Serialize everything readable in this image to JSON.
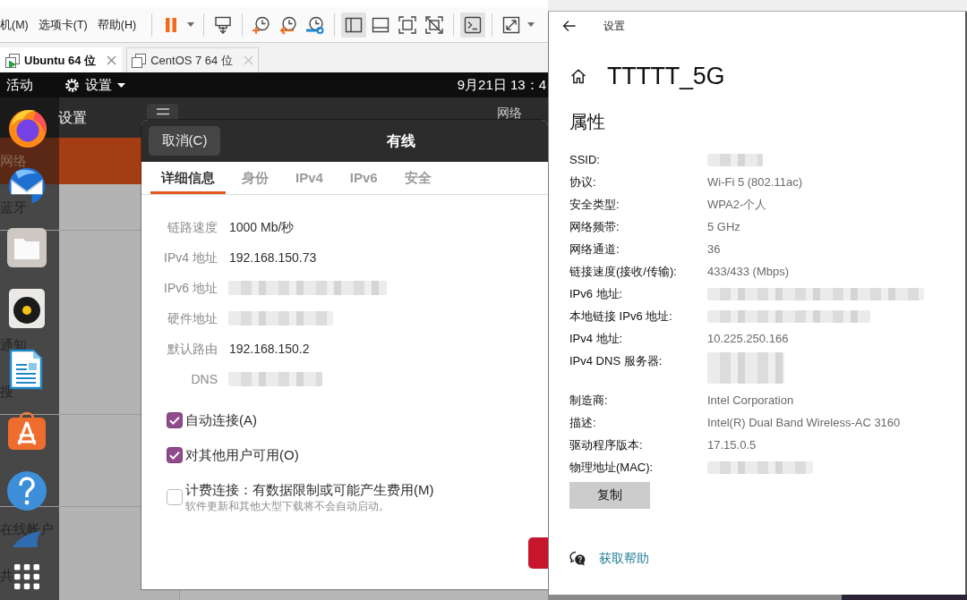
{
  "vmware": {
    "menu": [
      "机(M)",
      "选项卡(T)",
      "帮助(H)"
    ],
    "toolbar": [
      [
        {
          "on": false,
          "dropdown": true
        }
      ],
      [
        {
          "on": false,
          "dropdown": false
        }
      ],
      [
        {
          "on": false,
          "dropdown": false
        },
        {
          "on": false,
          "dropdown": false
        },
        {
          "on": false,
          "dropdown": false
        }
      ],
      [
        {
          "on": true,
          "dropdown": false
        },
        {
          "on": false,
          "dropdown": false
        },
        {
          "on": false,
          "dropdown": false
        },
        {
          "on": false,
          "dropdown": false
        }
      ],
      [
        {
          "on": true,
          "dropdown": false
        }
      ],
      [
        {
          "on": false,
          "dropdown": true
        }
      ]
    ],
    "tabs": [
      {
        "label": "Ubuntu 64 位",
        "selected": true,
        "running": true
      },
      {
        "label": "CentOS 7 64 位",
        "selected": false,
        "running": false
      }
    ]
  },
  "ubuntu": {
    "top_bar": {
      "activities": "活动",
      "app_menu": "设置",
      "clock": "9月21日 13：4"
    },
    "settings": {
      "title": "设置",
      "panel_title": "网络",
      "sidebar": [
        {
          "label": "网络",
          "selected": true,
          "group_start": false
        },
        {
          "label": "蓝牙",
          "selected": false,
          "group_start": false
        },
        {
          "selected": false,
          "group_start": true
        },
        {
          "selected": false,
          "group_start": false
        },
        {
          "label": "通知",
          "selected": false,
          "group_start": false
        },
        {
          "label": "搜",
          "selected": false,
          "group_start": false
        },
        {
          "selected": false,
          "group_start": true
        },
        {
          "selected": false,
          "group_start": false
        },
        {
          "label": "在线帐户",
          "selected": false,
          "group_start": true
        },
        {
          "label": "共",
          "selected": false,
          "group_start": false
        }
      ]
    },
    "dialog": {
      "cancel": "取消(C)",
      "title": "有线",
      "tabs": [
        {
          "label": "详细信息",
          "selected": true
        },
        {
          "label": "身份",
          "selected": false
        },
        {
          "label": "IPv4",
          "selected": false
        },
        {
          "label": "IPv6",
          "selected": false
        },
        {
          "label": "安全",
          "selected": false
        }
      ],
      "details": [
        {
          "label": "链路速度",
          "value": "1000 Mb/秒",
          "redacted": false
        },
        {
          "label": "IPv4 地址",
          "value": "192.168.150.73",
          "redacted": false
        },
        {
          "label": "IPv6 地址",
          "redacted": true
        },
        {
          "label": "硬件地址",
          "redacted": true
        },
        {
          "label": "默认路由",
          "value": "192.168.150.2",
          "redacted": false
        },
        {
          "label": "DNS",
          "redacted": true
        }
      ],
      "options": [
        {
          "label": "自动连接(A)",
          "checked": true
        },
        {
          "label": "对其他用户可用(O)",
          "checked": true
        },
        {
          "label": "计费连接：有数据限制或可能产生费用(M)",
          "hint": "软件更新和其他大型下载将不会自动启动。",
          "checked": false
        }
      ]
    }
  },
  "windows_settings": {
    "app_title": "设置",
    "network_name": "TTTTT_5G",
    "section": "属性",
    "properties": [
      {
        "label": "SSID:",
        "redacted": true,
        "multiline": false
      },
      {
        "label": "协议:",
        "value": "Wi-Fi 5 (802.11ac)",
        "redacted": false
      },
      {
        "label": "安全类型:",
        "value": "WPA2-个人",
        "redacted": false
      },
      {
        "label": "网络频带:",
        "value": "5 GHz",
        "redacted": false
      },
      {
        "label": "网络通道:",
        "value": "36",
        "redacted": false
      },
      {
        "label": "链接速度(接收/传输):",
        "value": "433/433 (Mbps)",
        "redacted": false
      },
      {
        "label": "IPv6 地址:",
        "redacted": true,
        "multiline": false
      },
      {
        "label": "本地链接 IPv6 地址:",
        "redacted": true,
        "multiline": false
      },
      {
        "label": "IPv4 地址:",
        "value": "10.225.250.166",
        "redacted": false
      },
      {
        "label": "IPv4 DNS 服务器:",
        "redacted": true,
        "multiline": true
      },
      {
        "label": "制造商:",
        "value": "Intel Corporation",
        "redacted": false
      },
      {
        "label": "描述:",
        "value": "Intel(R) Dual Band Wireless-AC 3160",
        "redacted": false
      },
      {
        "label": "驱动程序版本:",
        "value": "17.15.0.5",
        "redacted": false
      },
      {
        "label": "物理地址(MAC):",
        "redacted": true,
        "multiline": false
      }
    ],
    "copy_button": "复制",
    "help_link": "获取帮助"
  }
}
